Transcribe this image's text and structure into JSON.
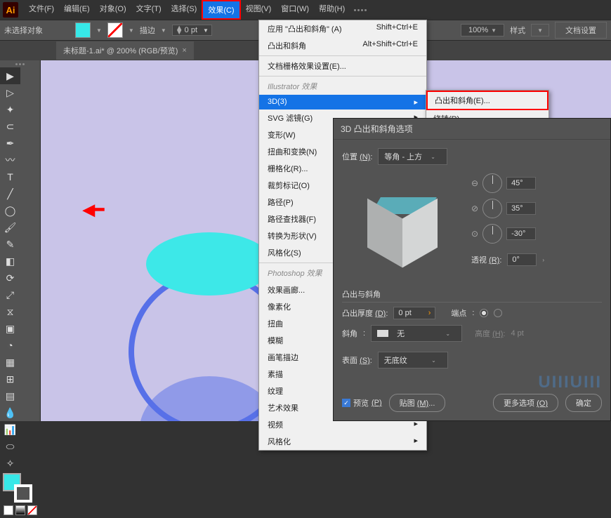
{
  "app": {
    "logo": "Ai"
  },
  "menu": {
    "items": [
      "文件(F)",
      "编辑(E)",
      "对象(O)",
      "文字(T)",
      "选择(S)",
      "效果(C)",
      "视图(V)",
      "窗口(W)",
      "帮助(H)"
    ],
    "activeIndex": 5
  },
  "control": {
    "noSelection": "未选择对象",
    "strokeLabel": "描边",
    "strokePt": "0 pt",
    "zoom": "100%",
    "styleLabel": "样式",
    "docSetup": "文档设置"
  },
  "tab": {
    "title": "未标题-1.ai* @ 200% (RGB/预览)"
  },
  "dropdown": {
    "top": [
      {
        "label": "应用 \"凸出和斜角\"  (A)",
        "shortcut": "Shift+Ctrl+E"
      },
      {
        "label": "凸出和斜角",
        "shortcut": "Alt+Shift+Ctrl+E"
      }
    ],
    "docGrid": "文档栅格效果设置(E)...",
    "illHeader": "Illustrator 效果",
    "ill": [
      {
        "label": "3D(3)",
        "arrow": true,
        "hl": true
      },
      {
        "label": "SVG 滤镜(G)",
        "arrow": true
      },
      {
        "label": "变形(W)",
        "arrow": true
      },
      {
        "label": "扭曲和变换(N)",
        "arrow": true
      },
      {
        "label": "栅格化(R)..."
      },
      {
        "label": "裁剪标记(O)"
      },
      {
        "label": "路径(P)",
        "arrow": true
      },
      {
        "label": "路径查找器(F)",
        "arrow": true
      },
      {
        "label": "转换为形状(V)",
        "arrow": true
      },
      {
        "label": "风格化(S)",
        "arrow": true
      }
    ],
    "psHeader": "Photoshop 效果",
    "ps": [
      "效果画廊...",
      "像素化",
      "扭曲",
      "模糊",
      "画笔描边",
      "素描",
      "纹理",
      "艺术效果",
      "视频",
      "风格化"
    ]
  },
  "submenu": {
    "items": [
      "凸出和斜角(E)...",
      "绕转(R)..."
    ]
  },
  "dialog": {
    "title": "3D 凸出和斜角选项",
    "posLabel": "位置",
    "posKey": "(N)",
    "posValue": "等角 - 上方",
    "rot": [
      {
        "v": "45°"
      },
      {
        "v": "35°"
      },
      {
        "v": "-30°"
      }
    ],
    "perspLabel": "透视",
    "perspKey": "(R)",
    "perspValue": "0°",
    "extrudeHeader": "凸出与斜角",
    "depthLabel": "凸出厚度",
    "depthKey": "(D)",
    "depthValue": "0 pt",
    "capLabel": "端点",
    "bevelLabel": "斜角",
    "bevelValue": "无",
    "heightLabel": "高度",
    "heightKey": "(H)",
    "heightValue": "4 pt",
    "surfaceLabel": "表面",
    "surfaceKey": "(S)",
    "surfaceValue": "无底纹",
    "preview": "预览",
    "previewKey": "(P)",
    "mapArt": "贴图",
    "mapKey": "(M)",
    "moreOpt": "更多选项",
    "moreKey": "(O)",
    "ok": "确定"
  },
  "watermark": "UIIIUIII"
}
